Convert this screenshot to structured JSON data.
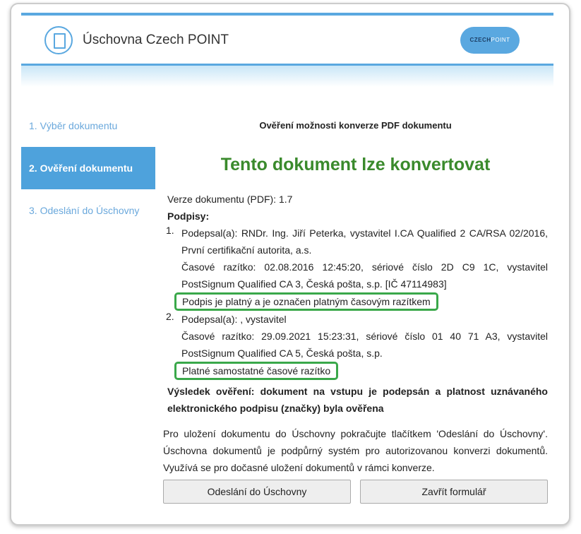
{
  "header": {
    "title": "Úschovna Czech POINT",
    "logo": "CZECHPOINT"
  },
  "nav": [
    "1. Výběr dokumentu",
    "2. Ověření dokumentu",
    "3. Odeslání do Úschovny"
  ],
  "main": {
    "heading": "Ověření možnosti konverze PDF dokumentu",
    "result_title": "Tento dokument lze konvertovat",
    "version": "Verze dokumentu (PDF): 1.7",
    "signatures_label": "Podpisy:",
    "signatures": [
      {
        "num": "1.",
        "signer": "Podepsal(a): RNDr. Ing. Jiří Peterka, vystavitel I.CA Qualified 2 CA/RSA 02/2016, První certifikační autorita, a.s.",
        "timestamp": "Časové razítko: 02.08.2016 12:45:20, sériové číslo 2D C9 1C, vystavitel PostSignum Qualified CA 3, Česká pošta, s.p. [IČ 47114983]",
        "status": "Podpis je platný a je označen platným časovým razítkem"
      },
      {
        "num": "2.",
        "signer": "Podepsal(a): , vystavitel",
        "timestamp": "Časové razítko: 29.09.2021 15:23:31, sériové číslo 01 40 71 A3, vystavitel PostSignum Qualified CA 5, Česká pošta, s.p.",
        "status": "Platné samostatné časové razítko"
      }
    ],
    "verification": "Výsledek ověření:  dokument na vstupu je podepsán a platnost uznávaného elektronického podpisu (značky) byla ověřena",
    "info": "Pro uložení dokumentu do Úschovny pokračujte tlačítkem 'Odeslání do Úschovny'. Úschovna dokumentů je podpůrný systém pro autorizovanou konverzi dokumentů. Využívá se pro dočasné uložení dokumentů v rámci konverze."
  },
  "buttons": {
    "send": "Odeslání do Úschovny",
    "close": "Zavřít formulář"
  }
}
